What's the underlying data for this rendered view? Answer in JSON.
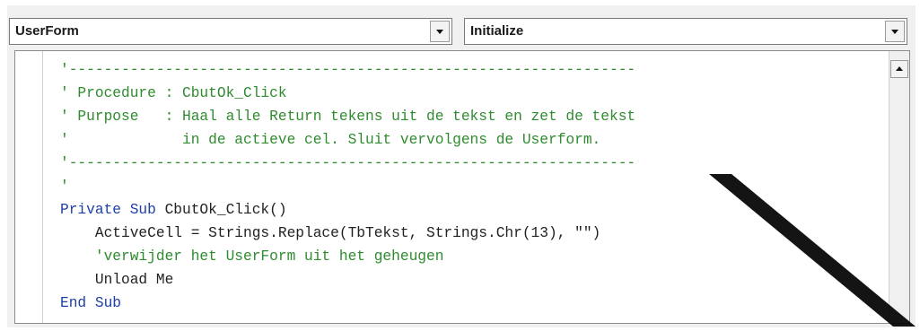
{
  "object_combo": {
    "value": "UserForm"
  },
  "procedure_combo": {
    "value": "Initialize"
  },
  "code_lines": [
    {
      "kind": "cmt",
      "text": "'-----------------------------------------------------------------"
    },
    {
      "kind": "cmt",
      "text": "' Procedure : CbutOk_Click"
    },
    {
      "kind": "cmt",
      "text": "' Purpose   : Haal alle Return tekens uit de tekst en zet de tekst"
    },
    {
      "kind": "cmt",
      "text": "'             in de actieve cel. Sluit vervolgens de Userform."
    },
    {
      "kind": "cmt",
      "text": "'-----------------------------------------------------------------"
    },
    {
      "kind": "cmt",
      "text": "'"
    },
    {
      "kind": "mix",
      "parts": [
        {
          "c": "kw",
          "t": "Private Sub "
        },
        {
          "c": "txt",
          "t": "CbutOk_Click()"
        }
      ]
    },
    {
      "kind": "txt",
      "text": "    ActiveCell = Strings.Replace(TbTekst, Strings.Chr(13), \"\")"
    },
    {
      "kind": "cmt",
      "text": "    'verwijder het UserForm uit het geheugen"
    },
    {
      "kind": "txt",
      "text": "    Unload Me"
    },
    {
      "kind": "kw",
      "text": "End Sub"
    }
  ],
  "colors": {
    "comment": "#2e8b2e",
    "keyword": "#1f3fa6",
    "text": "#222222"
  },
  "icons": {
    "combo_dropdown": "chevron-down-icon",
    "scroll_up": "chevron-up-icon"
  }
}
